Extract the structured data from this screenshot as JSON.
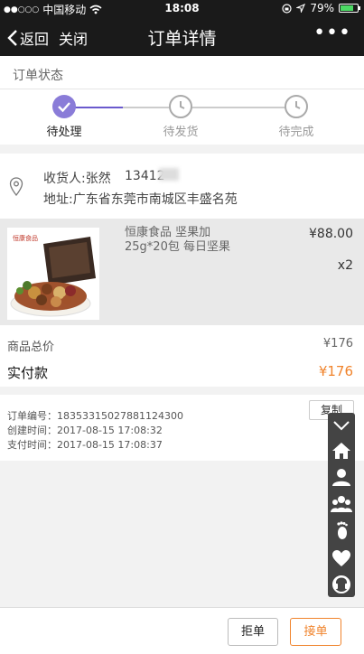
{
  "status_bar": {
    "carrier": "中国移动",
    "time": "18:08",
    "battery": "79%",
    "battery_level": 0.79,
    "signal_icon": "signal-dots-icon",
    "wifi_icon": "wifi-icon"
  },
  "navbar": {
    "back_label": "返回",
    "close_label": "关闭",
    "title": "订单详情",
    "more_label": "•••"
  },
  "order_status": {
    "section_label": "订单状态",
    "steps": [
      {
        "label": "待处理",
        "state": "active"
      },
      {
        "label": "待发货",
        "state": "pending"
      },
      {
        "label": "待完成",
        "state": "pending"
      }
    ],
    "colors": {
      "active": "#8a7cd8",
      "pending": "#aaaaaa"
    }
  },
  "address": {
    "recipient": "收货人:张然",
    "phone": "13412",
    "address": "地址:广东省东莞市南城区丰盛名苑"
  },
  "product": {
    "brand_logo_text": "恒康食品",
    "name": "恒康食品 坚果加25g*20包 每日坚果",
    "price": "¥88.00",
    "quantity": "x2"
  },
  "totals": {
    "subtotal_label": "商品总价",
    "subtotal_value": "¥176",
    "paid_label": "实付款",
    "paid_value": "¥176",
    "accent_color": "#f0832b"
  },
  "order_info": {
    "order_no": "订单编号：18353315027881124300",
    "created": "创建时间：2017-08-15 17:08:32",
    "paid": "支付时间：2017-08-15 17:08:37",
    "copy_label": "复制"
  },
  "side_toolbar": {
    "icons": [
      "chevron-down-icon",
      "home-icon",
      "user-icon",
      "group-icon",
      "footprint-icon",
      "heart-icon",
      "headset-icon"
    ]
  },
  "actions": {
    "reject_label": "拒单",
    "accept_label": "接单"
  }
}
